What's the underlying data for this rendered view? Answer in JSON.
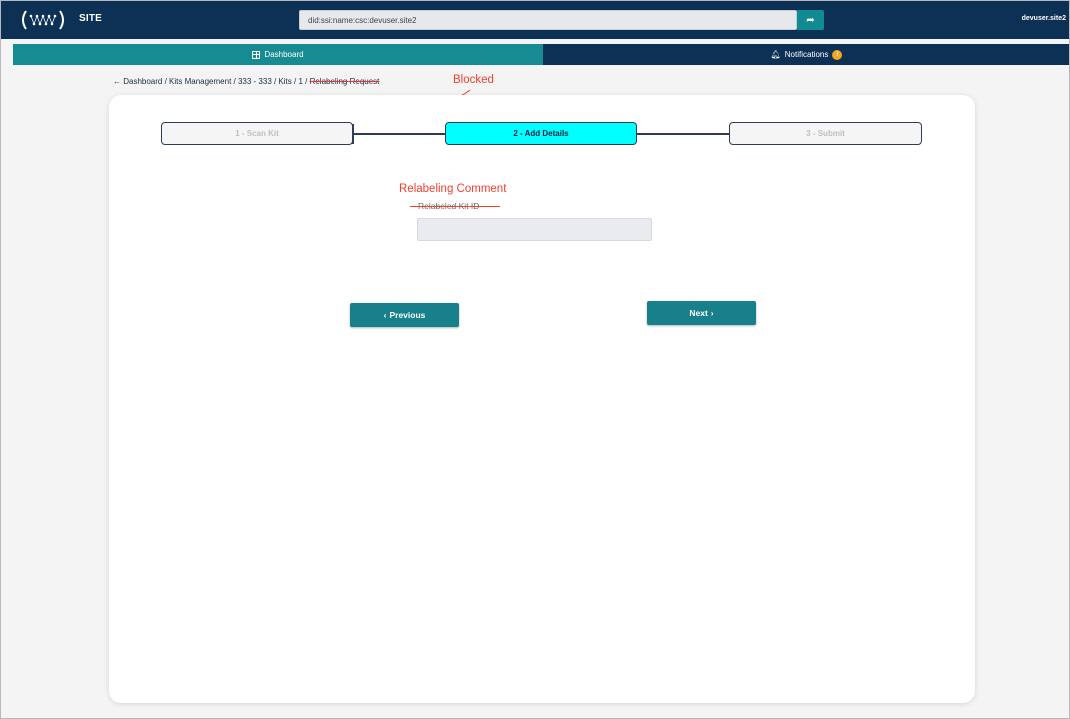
{
  "header": {
    "site_label": "SITE",
    "did_value": "did:ssi:name:csc:devuser.site2",
    "username": "devuser.site2",
    "logo_icon": "network-logo-icon",
    "go_icon": "share-arrow-icon"
  },
  "nav": {
    "dashboard_label": "Dashboard",
    "notifications_label": "Notifications",
    "notifications_badge": "!"
  },
  "breadcrumb": {
    "back_arrow": "←",
    "path": "Dashboard / Kits Management / 333 - 333 / Kits / 1 / ",
    "current": "Relabeling Request"
  },
  "annotations": {
    "blocked": "Blocked",
    "relabeling_comment": "Relabeling Comment"
  },
  "stepper": {
    "steps": [
      {
        "label": "1 - Scan Kit",
        "state": "inactive"
      },
      {
        "label": "2 - Add Details",
        "state": "active"
      },
      {
        "label": "3 - Submit",
        "state": "inactive"
      }
    ]
  },
  "form": {
    "field_label": "Relabeled Kit ID",
    "field_value": ""
  },
  "buttons": {
    "previous": "Previous",
    "next": "Next"
  },
  "colors": {
    "header_bg": "#0d3055",
    "teal": "#178b92",
    "active_step": "#00ffff",
    "annotation_red": "#ef4130"
  }
}
